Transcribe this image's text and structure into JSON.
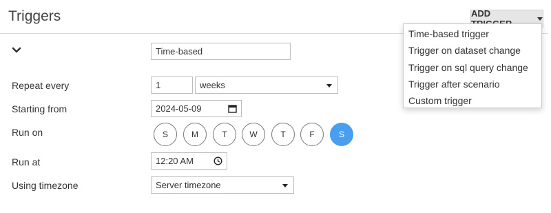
{
  "header": {
    "title": "Triggers",
    "add_trigger_label": "ADD TRIGGER"
  },
  "menu": {
    "items": [
      "Time-based trigger",
      "Trigger on dataset change",
      "Trigger on sql query change",
      "Trigger after scenario",
      "Custom trigger"
    ]
  },
  "trigger": {
    "name": "Time-based",
    "repeat_label": "Repeat every",
    "repeat_value": "1",
    "repeat_unit": "weeks",
    "start_label": "Starting from",
    "start_date": "2024-05-09",
    "run_on_label": "Run on",
    "days": [
      {
        "label": "S",
        "selected": false
      },
      {
        "label": "M",
        "selected": false
      },
      {
        "label": "T",
        "selected": false
      },
      {
        "label": "W",
        "selected": false
      },
      {
        "label": "T",
        "selected": false
      },
      {
        "label": "F",
        "selected": false
      },
      {
        "label": "S",
        "selected": true
      }
    ],
    "run_at_label": "Run at",
    "run_at_value": "12:20 AM",
    "timezone_label": "Using timezone",
    "timezone_value": "Server timezone"
  },
  "colors": {
    "accent": "#4a9ef0",
    "button_bg": "#e6e6e6"
  },
  "icons": {
    "collapse": "chevron-down-icon",
    "calendar": "calendar-icon",
    "clock": "clock-icon"
  }
}
